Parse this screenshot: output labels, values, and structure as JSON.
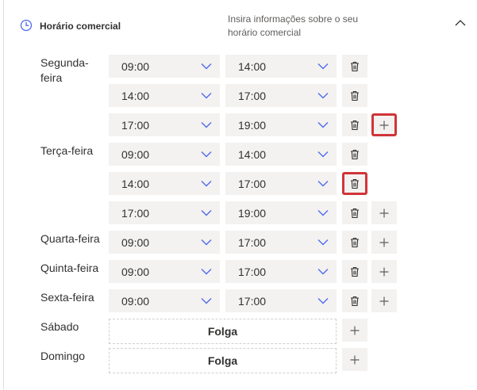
{
  "section": {
    "title": "Horário comercial",
    "description": "Insira informações sobre o seu horário comercial",
    "clock_icon": "clock-icon",
    "collapse_icon": "chevron-up-icon"
  },
  "days": [
    {
      "label": "Segunda-feira",
      "label_lines": [
        "Segunda-",
        "feira"
      ]
    },
    {
      "label": "Terça-feira"
    },
    {
      "label": "Quarta-feira"
    },
    {
      "label": "Quinta-feira"
    },
    {
      "label": "Sexta-feira"
    },
    {
      "label": "Sábado",
      "off_label": "Folga"
    },
    {
      "label": "Domingo",
      "off_label": "Folga"
    }
  ],
  "rows": [
    {
      "day": "Segunda-feira",
      "start": "09:00",
      "end": "14:00",
      "delete": true,
      "add": false,
      "highlight": "none"
    },
    {
      "day": "Segunda-feira",
      "start": "14:00",
      "end": "17:00",
      "delete": true,
      "add": false,
      "highlight": "none"
    },
    {
      "day": "Segunda-feira",
      "start": "17:00",
      "end": "19:00",
      "delete": true,
      "add": true,
      "highlight": "add"
    },
    {
      "day": "Terça-feira",
      "start": "09:00",
      "end": "14:00",
      "delete": true,
      "add": false,
      "highlight": "none"
    },
    {
      "day": "Terça-feira",
      "start": "14:00",
      "end": "17:00",
      "delete": true,
      "add": false,
      "highlight": "delete"
    },
    {
      "day": "Terça-feira",
      "start": "17:00",
      "end": "19:00",
      "delete": true,
      "add": true,
      "highlight": "none"
    },
    {
      "day": "Quarta-feira",
      "start": "09:00",
      "end": "17:00",
      "delete": true,
      "add": true,
      "highlight": "none"
    },
    {
      "day": "Quinta-feira",
      "start": "09:00",
      "end": "17:00",
      "delete": true,
      "add": true,
      "highlight": "none"
    },
    {
      "day": "Sexta-feira",
      "start": "09:00",
      "end": "17:00",
      "delete": true,
      "add": true,
      "highlight": "none"
    }
  ],
  "icons": {
    "dropdown": "chevron-down-icon",
    "delete": "trash-icon",
    "add": "plus-icon"
  },
  "colors": {
    "highlight": "#d13438",
    "control_bg": "#f3f2f1",
    "chevron": "#4f6bed"
  }
}
